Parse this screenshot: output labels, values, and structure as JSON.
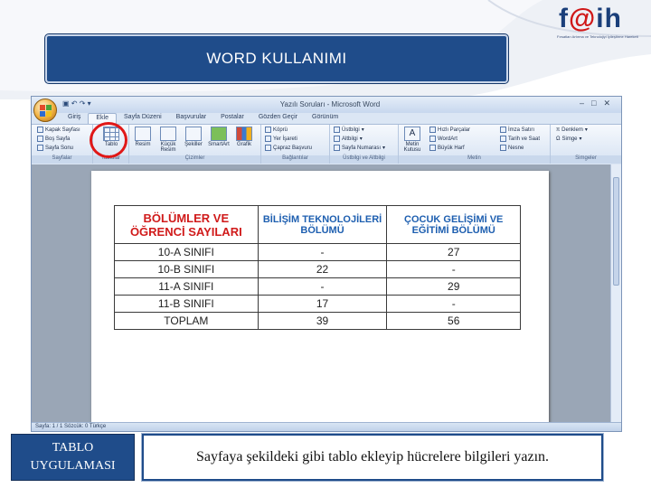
{
  "logo": {
    "text_pre": "f",
    "text_at": "@",
    "text_post": "ih",
    "subtitle": "Fırsatları Artırma ve Teknolojiyi İyileştirme Hareketi"
  },
  "slide": {
    "title": "WORD KULLANIMI",
    "label_line1": "TABLO",
    "label_line2": "UYGULAMASI",
    "caption": "Sayfaya şekildeki gibi tablo ekleyip hücrelere bilgileri yazın."
  },
  "word": {
    "window_title": "Yazılı Soruları - Microsoft Word",
    "tabs": [
      "Giriş",
      "Ekle",
      "Sayfa Düzeni",
      "Başvurular",
      "Postalar",
      "Gözden Geçir",
      "Görünüm"
    ],
    "active_tab": 1,
    "groups": {
      "pages": {
        "label": "Sayfalar",
        "items": [
          "Kapak Sayfası",
          "Boş Sayfa",
          "Sayfa Sonu"
        ]
      },
      "tables": {
        "label": "Tablolar",
        "item": "Tablo"
      },
      "illustrations": {
        "label": "Çizimler",
        "items": [
          "Resim",
          "Küçük Resim",
          "Şekiller",
          "SmartArt",
          "Grafik"
        ]
      },
      "links": {
        "label": "Bağlantılar",
        "items": [
          "Köprü",
          "Yer İşareti",
          "Çapraz Başvuru"
        ]
      },
      "header_footer": {
        "label": "Üstbilgi ve Altbilgi",
        "items": [
          "Üstbilgi",
          "Altbilgi",
          "Sayfa Numarası"
        ]
      },
      "text": {
        "label": "Metin",
        "big_item": "Metin Kutusu",
        "items": [
          "Hızlı Parçalar",
          "WordArt",
          "Büyük Harf"
        ],
        "items2": [
          "İmza Satırı",
          "Tarih ve Saat",
          "Nesne"
        ]
      },
      "symbols": {
        "label": "Simgeler",
        "items": [
          "Denklem",
          "Simge"
        ]
      }
    },
    "status": "Sayfa: 1 / 1   Sözcük: 0   Türkçe"
  },
  "table": {
    "headers": [
      "BÖLÜMLER VE ÖĞRENCİ SAYILARI",
      "BİLİŞİM TEKNOLOJİLERİ BÖLÜMÜ",
      "ÇOCUK GELİŞİMİ VE EĞİTİMİ BÖLÜMÜ"
    ],
    "rows": [
      [
        "10-A SINIFI",
        "-",
        "27"
      ],
      [
        "10-B SINIFI",
        "22",
        "-"
      ],
      [
        "11-A SINIFI",
        "-",
        "29"
      ],
      [
        "11-B SINIFI",
        "17",
        "-"
      ],
      [
        "TOPLAM",
        "39",
        "56"
      ]
    ]
  },
  "colors": {
    "accent": "#1f4c8a",
    "highlight": "#e01818",
    "header_red": "#d01a1a",
    "header_blue": "#1e5fb0"
  }
}
